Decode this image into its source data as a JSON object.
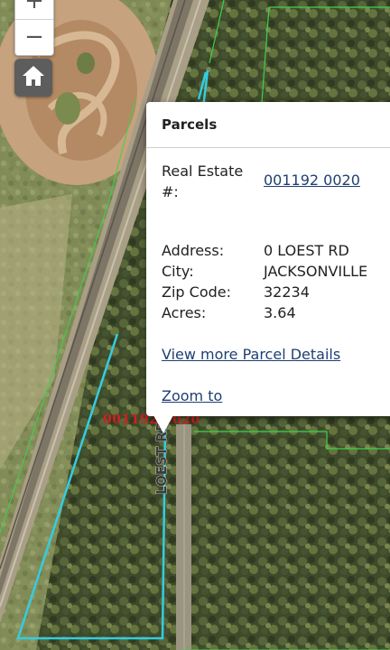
{
  "map": {
    "zoom_in_label": "+",
    "zoom_out_label": "−",
    "home_icon": "home-icon",
    "parcel_label": "001192 0020",
    "road_label": "LOEST RD",
    "colors": {
      "parcel_outline": "#34cde0",
      "parcel_outline_secondary": "#3fd24a",
      "parcel_text": "#d21f1f"
    }
  },
  "popup": {
    "title": "Parcels",
    "real_estate_label": "Real Estate #:",
    "real_estate_value": "001192 0020",
    "address_label": "Address:",
    "address_value": "0 LOEST RD",
    "city_label": "City:",
    "city_value": "JACKSONVILLE",
    "zip_label": "Zip Code:",
    "zip_value": "32234",
    "acres_label": "Acres:",
    "acres_value": "3.64",
    "more_details_link": "View more Parcel Details",
    "zoom_to_link": "Zoom to"
  }
}
